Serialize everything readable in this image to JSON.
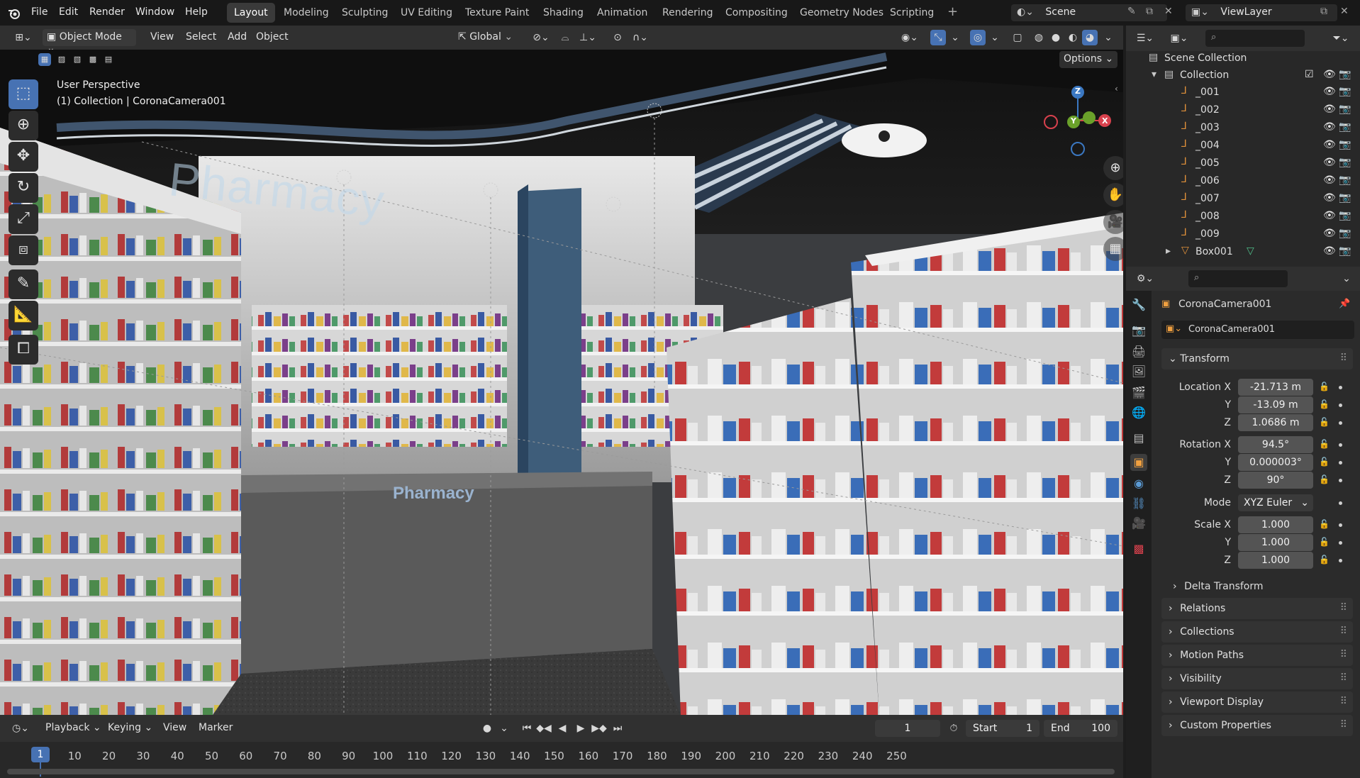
{
  "menu": [
    "File",
    "Edit",
    "Render",
    "Window",
    "Help"
  ],
  "workspaces": [
    "Layout",
    "Modeling",
    "Sculpting",
    "UV Editing",
    "Texture Paint",
    "Shading",
    "Animation",
    "Rendering",
    "Compositing",
    "Geometry Nodes",
    "Scripting"
  ],
  "active_workspace": "Layout",
  "scene": "Scene",
  "view_layer": "ViewLayer",
  "header": {
    "mode": "Object Mode",
    "menus": [
      "View",
      "Select",
      "Add",
      "Object"
    ],
    "orientation": "Global",
    "options": "Options"
  },
  "viewport": {
    "perspective": "User Perspective",
    "collection_info": "(1) Collection | CoronaCamera001",
    "wall_sign": "Pharmacy",
    "counter_sign": "Pharmacy",
    "axis_labels": {
      "z": "Z",
      "y": "Y",
      "x": "X"
    }
  },
  "outliner": {
    "root": "Scene Collection",
    "collection": "Collection",
    "items": [
      "_001",
      "_002",
      "_003",
      "_004",
      "_005",
      "_006",
      "_007",
      "_008",
      "_009",
      "Box001"
    ]
  },
  "properties": {
    "object_name": "CoronaCamera001",
    "data_name": "CoronaCamera001",
    "transform_title": "Transform",
    "location": {
      "label": "Location X",
      "x": "-21.713 m",
      "y": "-13.09 m",
      "z": "1.0686 m"
    },
    "rotation": {
      "label": "Rotation X",
      "x": "94.5°",
      "y": "0.000003°",
      "z": "90°"
    },
    "mode_label": "Mode",
    "mode": "XYZ Euler",
    "scale": {
      "label": "Scale X",
      "x": "1.000",
      "y": "1.000",
      "z": "1.000"
    },
    "axis_y": "Y",
    "axis_z": "Z",
    "sections": [
      "Delta Transform",
      "Relations",
      "Collections",
      "Motion Paths",
      "Visibility",
      "Viewport Display",
      "Custom Properties"
    ]
  },
  "timeline": {
    "menus": [
      "Playback",
      "Keying",
      "View",
      "Marker"
    ],
    "current_frame": "1",
    "start_label": "Start",
    "start": "1",
    "end_label": "End",
    "end": "100",
    "ticks": [
      "10",
      "20",
      "30",
      "40",
      "50",
      "60",
      "70",
      "80",
      "90",
      "100",
      "110",
      "120",
      "130",
      "140",
      "150",
      "160",
      "170",
      "180",
      "190",
      "200",
      "210",
      "220",
      "230",
      "240",
      "250"
    ],
    "playhead": "1"
  },
  "colors": {
    "accent": "#4772b3",
    "x_axis": "#d8414d",
    "y_axis": "#6aa12a",
    "z_axis": "#3b78c2"
  }
}
